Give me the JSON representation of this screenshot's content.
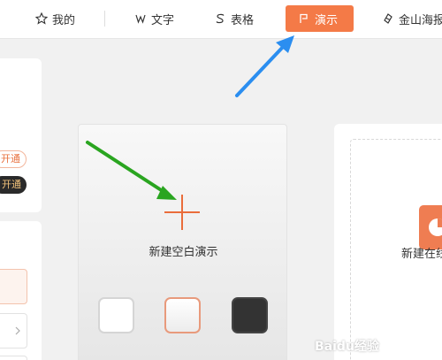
{
  "nav": {
    "items": [
      {
        "label": "我的",
        "icon": "star-icon"
      },
      {
        "label": "文字",
        "icon": "writer-icon"
      },
      {
        "label": "表格",
        "icon": "sheet-icon"
      },
      {
        "label": "演示",
        "icon": "presentation-icon",
        "active": true
      },
      {
        "label": "金山海报",
        "icon": "poster-icon"
      }
    ]
  },
  "left_panel": {
    "pill_outline_label": "开通",
    "pill_dark_label": "开通"
  },
  "new_blank": {
    "label": "新建空白演示",
    "swatches": [
      "white",
      "light-gradient",
      "dark"
    ]
  },
  "right_card": {
    "label": "新建在线"
  },
  "watermark": "Baidu经验",
  "colors": {
    "accent": "#f47a47",
    "blue_arrow": "#2b8ef0",
    "green_arrow": "#2aa520"
  }
}
